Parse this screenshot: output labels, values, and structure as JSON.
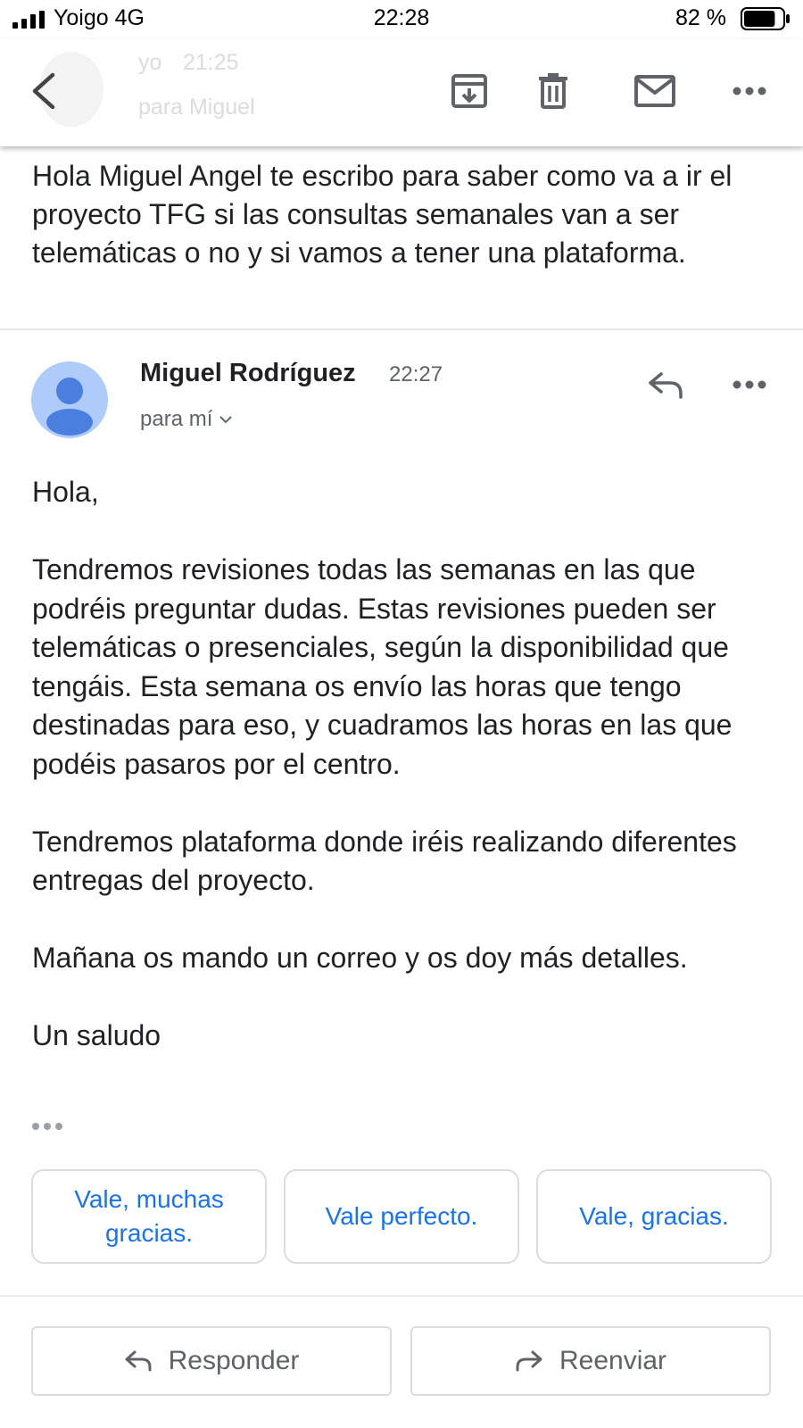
{
  "status_bar": {
    "carrier": "Yoigo 4G",
    "time": "22:28",
    "battery": "82 %",
    "battery_level": 0.82
  },
  "toolbar": {
    "ghost_sender": "yo",
    "ghost_time": "21:25",
    "ghost_recipient": "para Miguel"
  },
  "previous_message": {
    "body": "Hola Miguel Angel te escribo para saber como va a ir el proyecto TFG si las consultas semanales van a ser  telemáticas o no y si vamos a tener una plataforma."
  },
  "message": {
    "sender": "Miguel Rodríguez",
    "time": "22:27",
    "recipient": "para mí",
    "paragraphs": [
      "Hola,",
      "Tendremos revisiones todas las semanas en las que podréis preguntar dudas. Estas revisiones pueden ser telemáticas o presenciales, según la disponibilidad que tengáis. Esta semana os envío las horas que tengo destinadas para eso, y cuadramos las horas en las que podéis pasaros por el centro.",
      "Tendremos plataforma donde iréis realizando diferentes entregas del proyecto.",
      "Mañana os mando un correo y os doy más detalles.",
      "Un saludo"
    ]
  },
  "smart_replies": [
    "Vale, muchas gracias.",
    "Vale perfecto.",
    "Vale, gracias."
  ],
  "actions": {
    "reply": "Responder",
    "forward": "Reenviar"
  },
  "colors": {
    "accent": "#1a73e8",
    "avatar_bg": "#aecbfa",
    "avatar_fg": "#4a7fe0"
  }
}
